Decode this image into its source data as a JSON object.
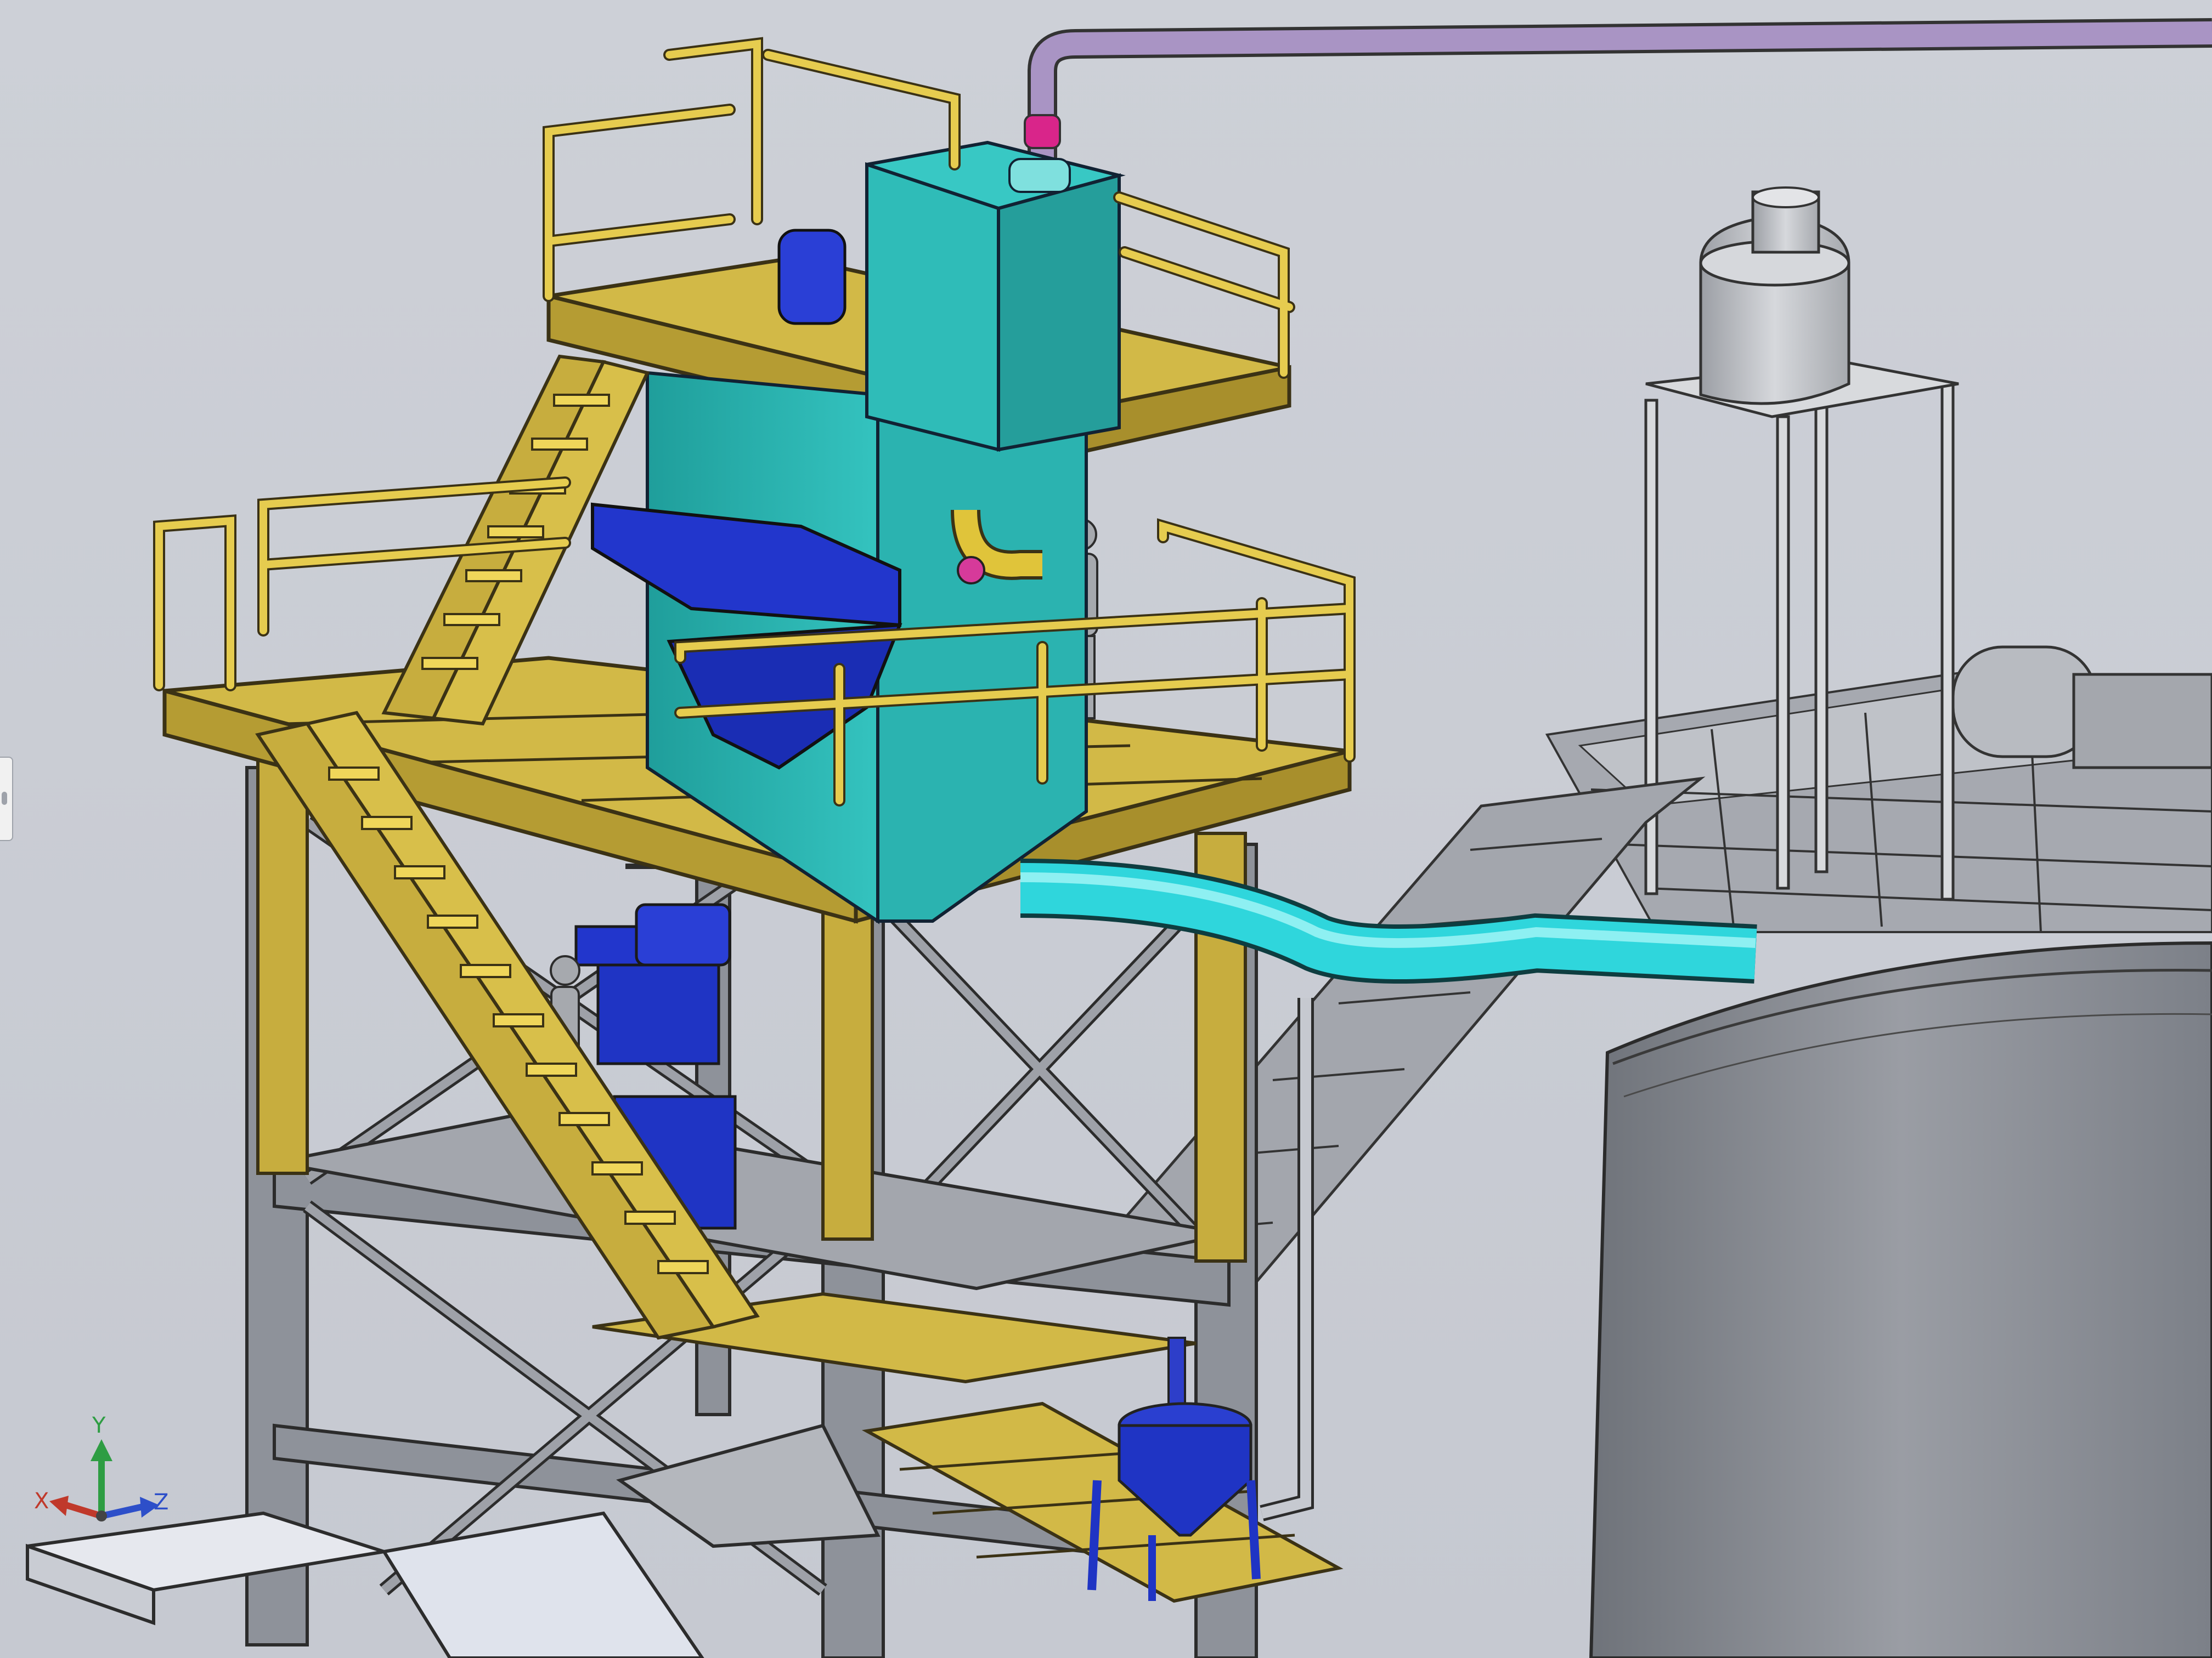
{
  "viewport": {
    "scene": "industrial-plant-3d-model",
    "colors": {
      "background": "#c9ccd3",
      "structure_steel": "#8e929a",
      "platform_yellow": "#d2b947",
      "handrail_yellow": "#e6cc4f",
      "tank_teal": "#2bb3b0",
      "pipe_cyan": "#2fd6dc",
      "equipment_blue": "#1f34c4",
      "pipe_purple": "#9a86b8",
      "tank_gray": "#8b8e95"
    }
  },
  "triad": {
    "x_label": "X",
    "y_label": "Y",
    "z_label": "Z",
    "x_color": "#c0392b",
    "y_color": "#2e9d43",
    "z_color": "#2d4fc9"
  },
  "side_panel": {
    "tab_icon": "panel-toggle-icon"
  }
}
